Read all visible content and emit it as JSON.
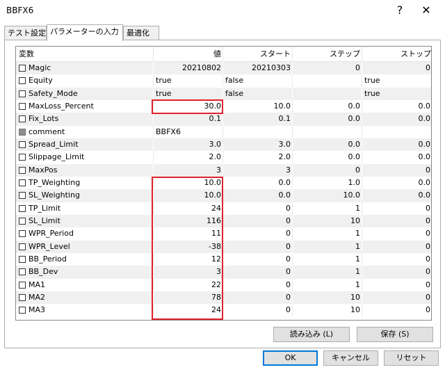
{
  "window": {
    "title": "BBFX6",
    "help_label": "?",
    "close_label": "✕"
  },
  "tabs": [
    "テスト設定",
    "パラメーターの入力",
    "最適化"
  ],
  "columns": [
    "変数",
    "値",
    "スタート",
    "ステップ",
    "ストップ"
  ],
  "rows": [
    {
      "name": "Magic",
      "value": "20210802",
      "start": "20210303",
      "step": "0",
      "stop": "0",
      "text": false,
      "gray": false
    },
    {
      "name": "Equity",
      "value": "true",
      "start": "false",
      "step": "",
      "stop": "true",
      "text": true,
      "gray": false
    },
    {
      "name": "Safety_Mode",
      "value": "true",
      "start": "false",
      "step": "",
      "stop": "true",
      "text": true,
      "gray": false
    },
    {
      "name": "MaxLoss_Percent",
      "value": "30.0",
      "start": "10.0",
      "step": "0.0",
      "stop": "0.0",
      "text": false,
      "gray": false
    },
    {
      "name": "Fix_Lots",
      "value": "0.1",
      "start": "0.1",
      "step": "0.0",
      "stop": "0.0",
      "text": false,
      "gray": false
    },
    {
      "name": "comment",
      "value": "BBFX6",
      "start": "",
      "step": "",
      "stop": "",
      "text": true,
      "gray": true
    },
    {
      "name": "Spread_Limit",
      "value": "3.0",
      "start": "3.0",
      "step": "0.0",
      "stop": "0.0",
      "text": false,
      "gray": false
    },
    {
      "name": "Slippage_Limit",
      "value": "2.0",
      "start": "2.0",
      "step": "0.0",
      "stop": "0.0",
      "text": false,
      "gray": false
    },
    {
      "name": "MaxPos",
      "value": "3",
      "start": "3",
      "step": "0",
      "stop": "0",
      "text": false,
      "gray": false
    },
    {
      "name": "TP_Weighting",
      "value": "10.0",
      "start": "0.0",
      "step": "1.0",
      "stop": "0.0",
      "text": false,
      "gray": false
    },
    {
      "name": "SL_Weighting",
      "value": "10.0",
      "start": "0.0",
      "step": "10.0",
      "stop": "0.0",
      "text": false,
      "gray": false
    },
    {
      "name": "TP_Limit",
      "value": "24",
      "start": "0",
      "step": "1",
      "stop": "0",
      "text": false,
      "gray": false
    },
    {
      "name": "SL_Limit",
      "value": "116",
      "start": "0",
      "step": "10",
      "stop": "0",
      "text": false,
      "gray": false
    },
    {
      "name": "WPR_Period",
      "value": "11",
      "start": "0",
      "step": "1",
      "stop": "0",
      "text": false,
      "gray": false
    },
    {
      "name": "WPR_Level",
      "value": "-38",
      "start": "0",
      "step": "1",
      "stop": "0",
      "text": false,
      "gray": false
    },
    {
      "name": "BB_Period",
      "value": "12",
      "start": "0",
      "step": "1",
      "stop": "0",
      "text": false,
      "gray": false
    },
    {
      "name": "BB_Dev",
      "value": "3",
      "start": "0",
      "step": "1",
      "stop": "0",
      "text": false,
      "gray": false
    },
    {
      "name": "MA1",
      "value": "22",
      "start": "0",
      "step": "1",
      "stop": "0",
      "text": false,
      "gray": false
    },
    {
      "name": "MA2",
      "value": "78",
      "start": "0",
      "step": "10",
      "stop": "0",
      "text": false,
      "gray": false
    },
    {
      "name": "MA3",
      "value": "24",
      "start": "0",
      "step": "10",
      "stop": "0",
      "text": false,
      "gray": false
    }
  ],
  "buttons": {
    "load": "読み込み (L)",
    "save": "保存 (S)",
    "ok": "OK",
    "cancel": "キャンセル",
    "reset": "リセット"
  },
  "colors": {
    "highlight": "#e0212b",
    "accent": "#0078d7"
  }
}
